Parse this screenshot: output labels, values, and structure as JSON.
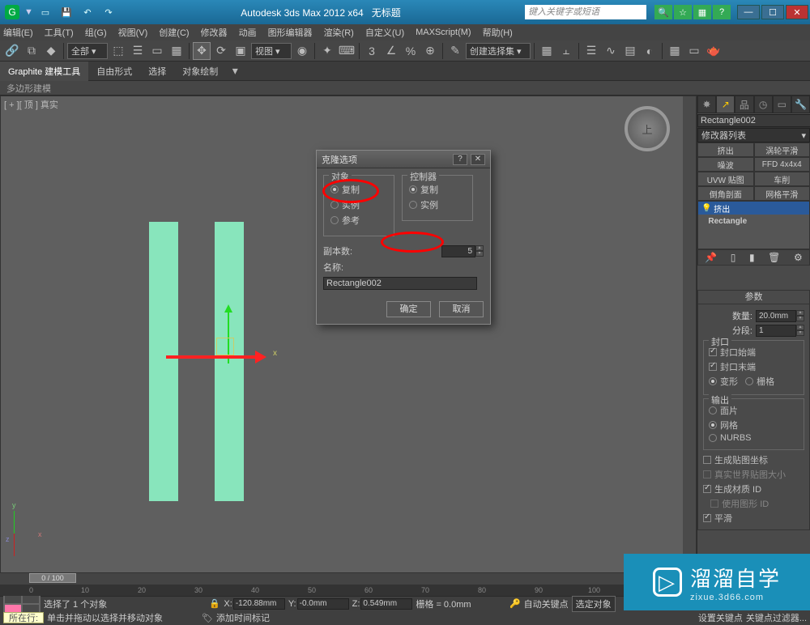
{
  "title": {
    "app": "Autodesk 3ds Max 2012 x64",
    "doc": "无标题"
  },
  "search_placeholder": "键入关键字或短语",
  "menus": [
    "编辑(E)",
    "工具(T)",
    "组(G)",
    "视图(V)",
    "创建(C)",
    "修改器",
    "动画",
    "图形编辑器",
    "渲染(R)",
    "自定义(U)",
    "MAXScript(M)",
    "帮助(H)"
  ],
  "toolbar": {
    "all": "全部 ▾",
    "view": "视图 ▾",
    "selset": "创建选择集 ▾"
  },
  "ribbon": {
    "tab1": "Graphite 建模工具",
    "tab2": "自由形式",
    "tab3": "选择",
    "tab4": "对象绘制",
    "row2": "多边形建模"
  },
  "vp_label": "[ + ][ 顶 ] 真实",
  "viewcube": "上",
  "dialog": {
    "title": "克隆选项",
    "obj_legend": "对象",
    "obj_copy": "复制",
    "obj_inst": "实例",
    "obj_ref": "参考",
    "ctrl_legend": "控制器",
    "ctrl_copy": "复制",
    "ctrl_inst": "实例",
    "copies_lbl": "副本数:",
    "copies_val": "5",
    "name_lbl": "名称:",
    "name_val": "Rectangle002",
    "ok": "确定",
    "cancel": "取消"
  },
  "panel": {
    "objname": "Rectangle002",
    "modlist": "修改器列表",
    "mods": [
      "挤出",
      "涡轮平滑",
      "噪波",
      "FFD 4x4x4",
      "UVW 贴图",
      "车削",
      "倒角剖面",
      "网格平滑"
    ],
    "stack": [
      "挤出",
      "Rectangle"
    ],
    "rollout_params": "参数",
    "amount_lbl": "数量:",
    "amount_val": "20.0mm",
    "segs_lbl": "分段:",
    "segs_val": "1",
    "cap_legend": "封口",
    "cap_start": "封口始端",
    "cap_end": "封口末端",
    "morph": "变形",
    "grid": "栅格",
    "out_legend": "输出",
    "out_patch": "面片",
    "out_mesh": "网格",
    "out_nurbs": "NURBS",
    "gen_map": "生成贴图坐标",
    "real_world": "真实世界贴图大小",
    "gen_mat": "生成材质 ID",
    "use_shape": "使用图形 ID",
    "smooth": "平滑"
  },
  "status": {
    "sel": "选择了 1 个对象",
    "hint": "单击并拖动以选择并移动对象",
    "x": "-120.88mm",
    "y": "-0.0mm",
    "z": "0.549mm",
    "grid": "栅格 = 0.0mm",
    "autokey": "自动关键点",
    "selfilter": "选定对象",
    "setkey": "设置关键点",
    "keyfilter": "关键点过滤器...",
    "timetag": "添加时间标记",
    "hot": "所在行:",
    "frame": "0 / 100"
  },
  "watermark": {
    "brand": "溜溜自学",
    "sub": "zixue.3d66.com"
  }
}
